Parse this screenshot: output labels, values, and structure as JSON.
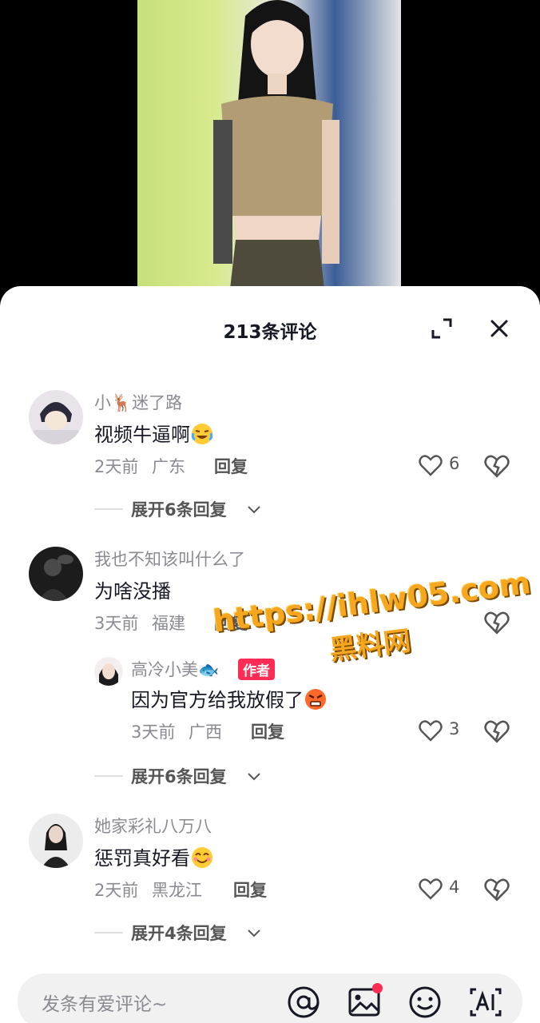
{
  "header": {
    "title": "213条评论",
    "expand_icon": "expand-icon",
    "close_icon": "close-icon"
  },
  "comments": [
    {
      "user": "小🦌迷了路",
      "text": "视频牛逼啊",
      "emoji": "laughing-crying-emoji",
      "time": "2天前",
      "location": "广东",
      "reply_label": "回复",
      "likes": "6",
      "expand_label": "展开6条回复"
    },
    {
      "user": "我也不知该叫什么了",
      "text": "为啥没播",
      "time": "3天前",
      "location": "福建",
      "reply_label": "回复",
      "sub_reply": {
        "user": "高冷小美🐟",
        "badge": "作者",
        "text": "因为官方给我放假了",
        "emoji": "angry-emoji",
        "time": "3天前",
        "location": "广西",
        "reply_label": "回复",
        "likes": "3"
      },
      "expand_label": "展开6条回复"
    },
    {
      "user": "她家彩礼八万八",
      "text": "惩罚真好看",
      "emoji": "smiling-emoji",
      "time": "2天前",
      "location": "黑龙江",
      "reply_label": "回复",
      "likes": "4",
      "expand_label": "展开4条回复"
    }
  ],
  "watermark": {
    "url": "https://ihlw05.com",
    "name": "黑料网"
  },
  "input": {
    "placeholder": "发条有爱评论~",
    "icons": [
      "at-icon",
      "image-icon",
      "emoji-icon",
      "ai-icon"
    ]
  },
  "colors": {
    "accent": "#fe2c55",
    "watermark": "#f7a71e",
    "muted_text": "#8a8b91",
    "text": "#161823"
  }
}
